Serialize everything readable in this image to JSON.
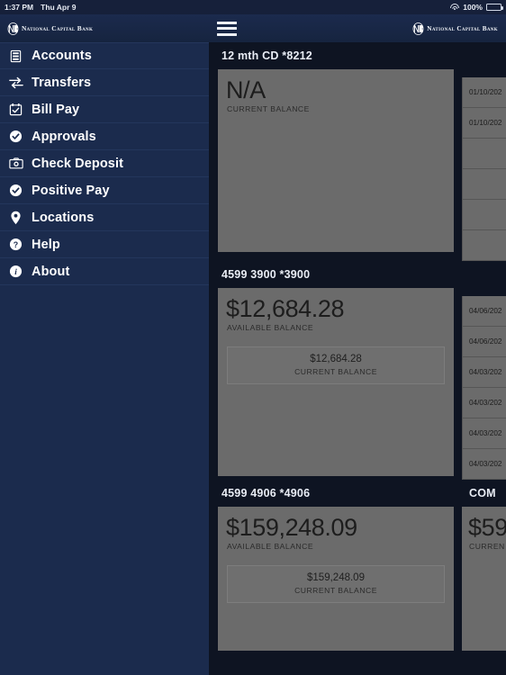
{
  "statusbar": {
    "time": "1:37 PM",
    "date": "Thu Apr 9",
    "wifi_icon": "wifi-icon",
    "battery_pct": "100%",
    "battery_icon": "battery-full-icon"
  },
  "header": {
    "logo_left_text": "National Capital Bank",
    "logo_right_text": "National Capital Bank",
    "logo_mark": "ncb-monogram-icon",
    "menu_icon": "hamburger-menu-icon"
  },
  "sidebar": {
    "items": [
      {
        "label": "Accounts",
        "icon": "accounts-icon"
      },
      {
        "label": "Transfers",
        "icon": "transfers-icon"
      },
      {
        "label": "Bill Pay",
        "icon": "calendar-check-icon"
      },
      {
        "label": "Approvals",
        "icon": "check-circle-icon"
      },
      {
        "label": "Check Deposit",
        "icon": "camera-icon"
      },
      {
        "label": "Positive Pay",
        "icon": "check-circle-icon"
      },
      {
        "label": "Locations",
        "icon": "map-pin-icon"
      },
      {
        "label": "Help",
        "icon": "question-circle-icon"
      },
      {
        "label": "About",
        "icon": "info-circle-icon"
      }
    ]
  },
  "accounts": [
    {
      "title": "12 mth CD *8212",
      "available_balance": "N/A",
      "available_label": "CURRENT BALANCE",
      "has_current_box": false,
      "transactions": [
        {
          "date": "01/10/202"
        },
        {
          "date": "01/10/202"
        },
        {
          "date": ""
        },
        {
          "date": ""
        },
        {
          "date": ""
        },
        {
          "date": ""
        }
      ]
    },
    {
      "title": "4599 3900 *3900",
      "available_balance": "$12,684.28",
      "available_label": "AVAILABLE BALANCE",
      "has_current_box": true,
      "current_balance": "$12,684.28",
      "current_label": "CURRENT BALANCE",
      "transactions": [
        {
          "date": "04/06/202"
        },
        {
          "date": "04/06/202"
        },
        {
          "date": "04/03/202"
        },
        {
          "date": "04/03/202"
        },
        {
          "date": "04/03/202"
        },
        {
          "date": "04/03/202"
        }
      ]
    },
    {
      "title": "4599 4906 *4906",
      "available_balance": "$159,248.09",
      "available_label": "AVAILABLE BALANCE",
      "has_current_box": true,
      "current_balance": "$159,248.09",
      "current_label": "CURRENT BALANCE"
    }
  ],
  "side_account": {
    "title": "COM",
    "available_balance": "$59",
    "available_label": "CURREN"
  },
  "colors": {
    "sidebar_bg": "#1b2b4d",
    "content_bg": "#0e1422",
    "card_bg": "#6b6b6b",
    "header_bg": "#1b2a4d",
    "text_light": "#ffffff"
  }
}
